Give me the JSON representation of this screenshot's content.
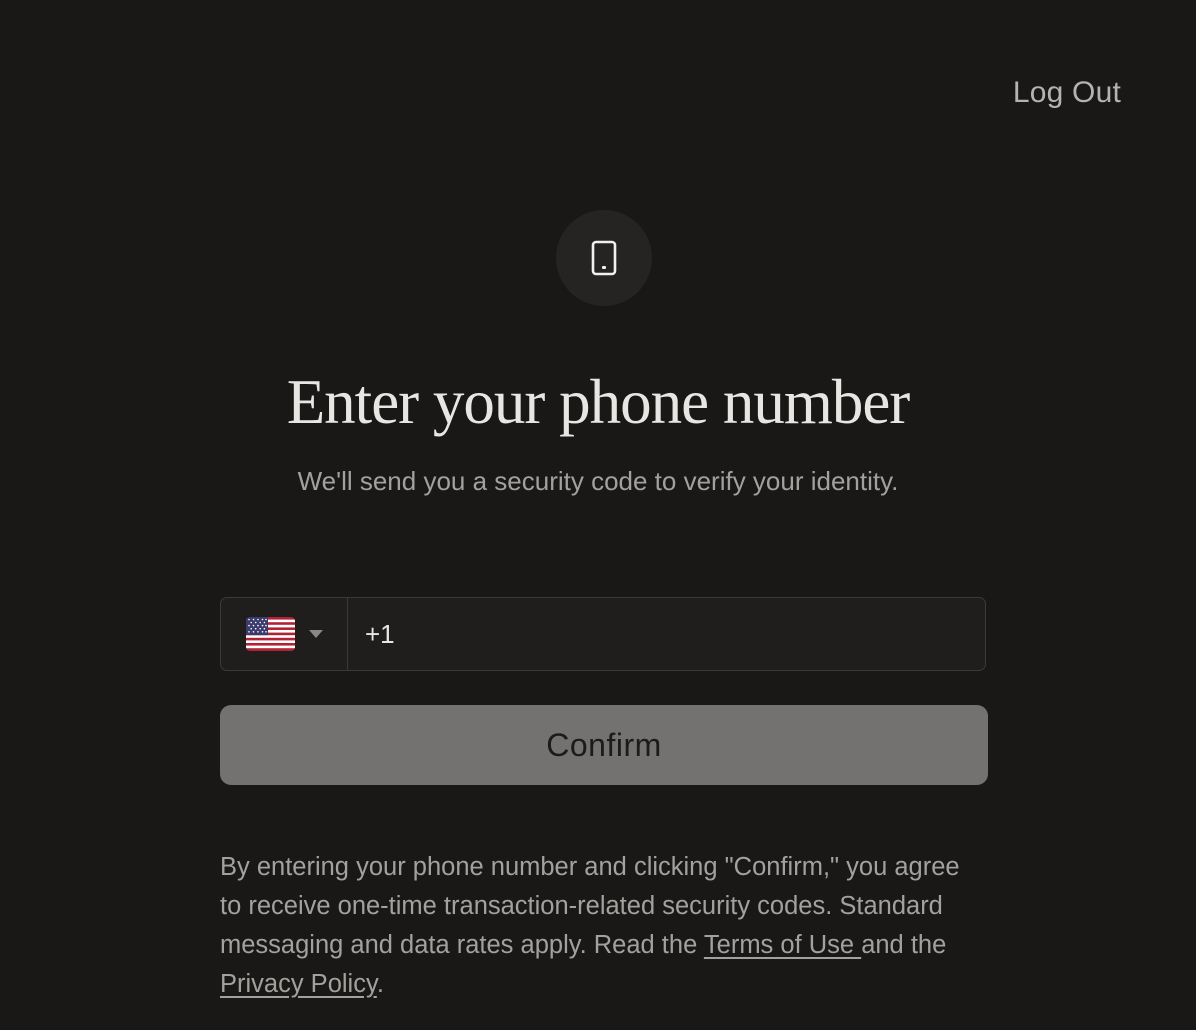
{
  "header": {
    "logout_label": "Log Out"
  },
  "hero": {
    "icon": "mobile-phone-icon",
    "title": "Enter your phone number",
    "subtitle": "We'll send you a security code to verify your identity."
  },
  "phone_form": {
    "country_flag": "us-flag-icon",
    "country_code_value": "+1",
    "confirm_label": "Confirm"
  },
  "legal": {
    "text_1": "By entering your phone number and clicking \"Confirm,\" you agree to receive one-time transaction-related security codes. Standard messaging and data rates apply. Read the ",
    "terms_link": "Terms of Use ",
    "text_2": "and the ",
    "privacy_link": "Privacy Policy",
    "text_3": "."
  },
  "colors": {
    "background": "#191817",
    "button_disabled": "#737271",
    "text_primary": "#e8e6e3",
    "text_muted": "#a3a19e"
  }
}
